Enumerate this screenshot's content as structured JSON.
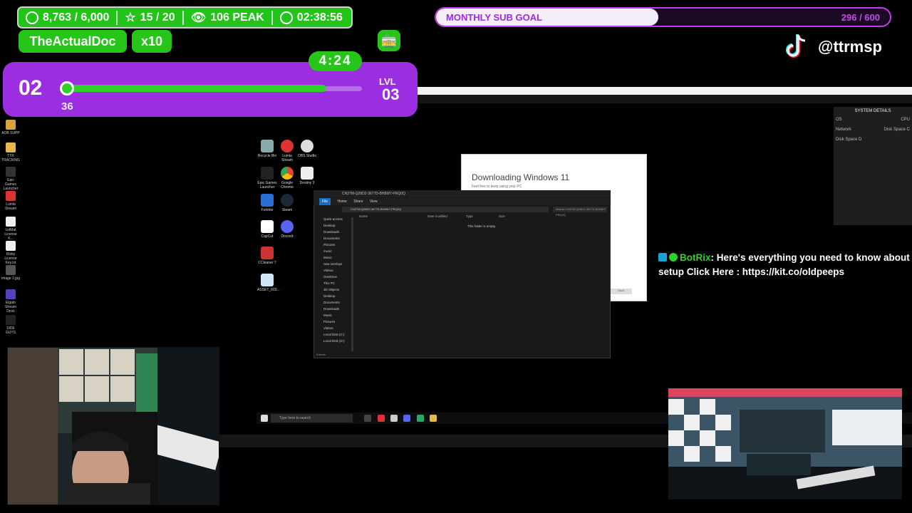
{
  "stats": {
    "followers": "8,763 / 6,000",
    "stars": "15 / 20",
    "viewers": "106 PEAK",
    "uptime": "02:38:56"
  },
  "user": {
    "name": "TheActualDoc",
    "multiplier": "x10"
  },
  "level": {
    "current": "02",
    "xp": "36",
    "timer": "4:24",
    "next_label": "LVL",
    "next": "03",
    "progress_fraction": 0.88
  },
  "sub_goal": {
    "label": "MONTHLY SUB GOAL",
    "count": "296 / 600",
    "fraction": 0.49
  },
  "tiktok": {
    "handle": "@ttrmsp"
  },
  "chat": [
    {
      "user": "BotRix",
      "text": ": Here's everything you need to know about Pe",
      "line2": "setup Click Here : https://kit.co/oldpeeps"
    }
  ],
  "desktop": {
    "icons": [
      "Recycle Bin",
      "Lumia Stream",
      "OBS Studio",
      "Epic Games Launcher",
      "Google Chrome",
      "Destiny 2",
      "Fortnite",
      "Steam",
      "CapCut",
      "Discord",
      "CCleaner 7",
      "ASSET_603..."
    ],
    "left_dock": [
      "AOB SUPP",
      "TTR TRACKING",
      "Epic Games Launcher",
      "Lumia Stream",
      "LidMat License K...",
      "Ricky License Key.txt",
      "image 2.jpg",
      "Elgato Stream Deck",
      "SIDE GUYS"
    ]
  },
  "setup": {
    "title": "Downloading Windows 11",
    "subtitle": "Feel free to keep using your PC",
    "button": "Back"
  },
  "explorer": {
    "title": "CN27M-Q28D2-3677D-BH8W7-PRQ0Q",
    "tabs": [
      "File",
      "Home",
      "Share",
      "View"
    ],
    "path": "CN27M-Q28D2-3677D-BH8W7-PRQ0Q",
    "search_placeholder": "Search CN27M-Q28D2-3677D-BH8W7-PRQ0Q",
    "columns": [
      "Name",
      "Date modified",
      "Type",
      "Size"
    ],
    "empty_text": "This folder is empty.",
    "nav": [
      "Quick access",
      "Desktop",
      "Downloads",
      "Documents",
      "Pictures",
      "music",
      "Music",
      "new overlays",
      "Videos",
      "OneDrive",
      "This PC",
      "3D Objects",
      "Desktop",
      "Documents",
      "Downloads",
      "Music",
      "Pictures",
      "Videos",
      "Local Disk (C:)",
      "Local Disk (D:)"
    ],
    "footer": "0 items"
  },
  "taskbar": {
    "search_placeholder": "Type here to search"
  },
  "system_details": {
    "header": "SYSTEM DETAILS",
    "rows": [
      [
        "OS",
        "CPU"
      ],
      [
        "Network",
        "Disk Space C"
      ],
      [
        "Disk Space D",
        ""
      ]
    ]
  }
}
